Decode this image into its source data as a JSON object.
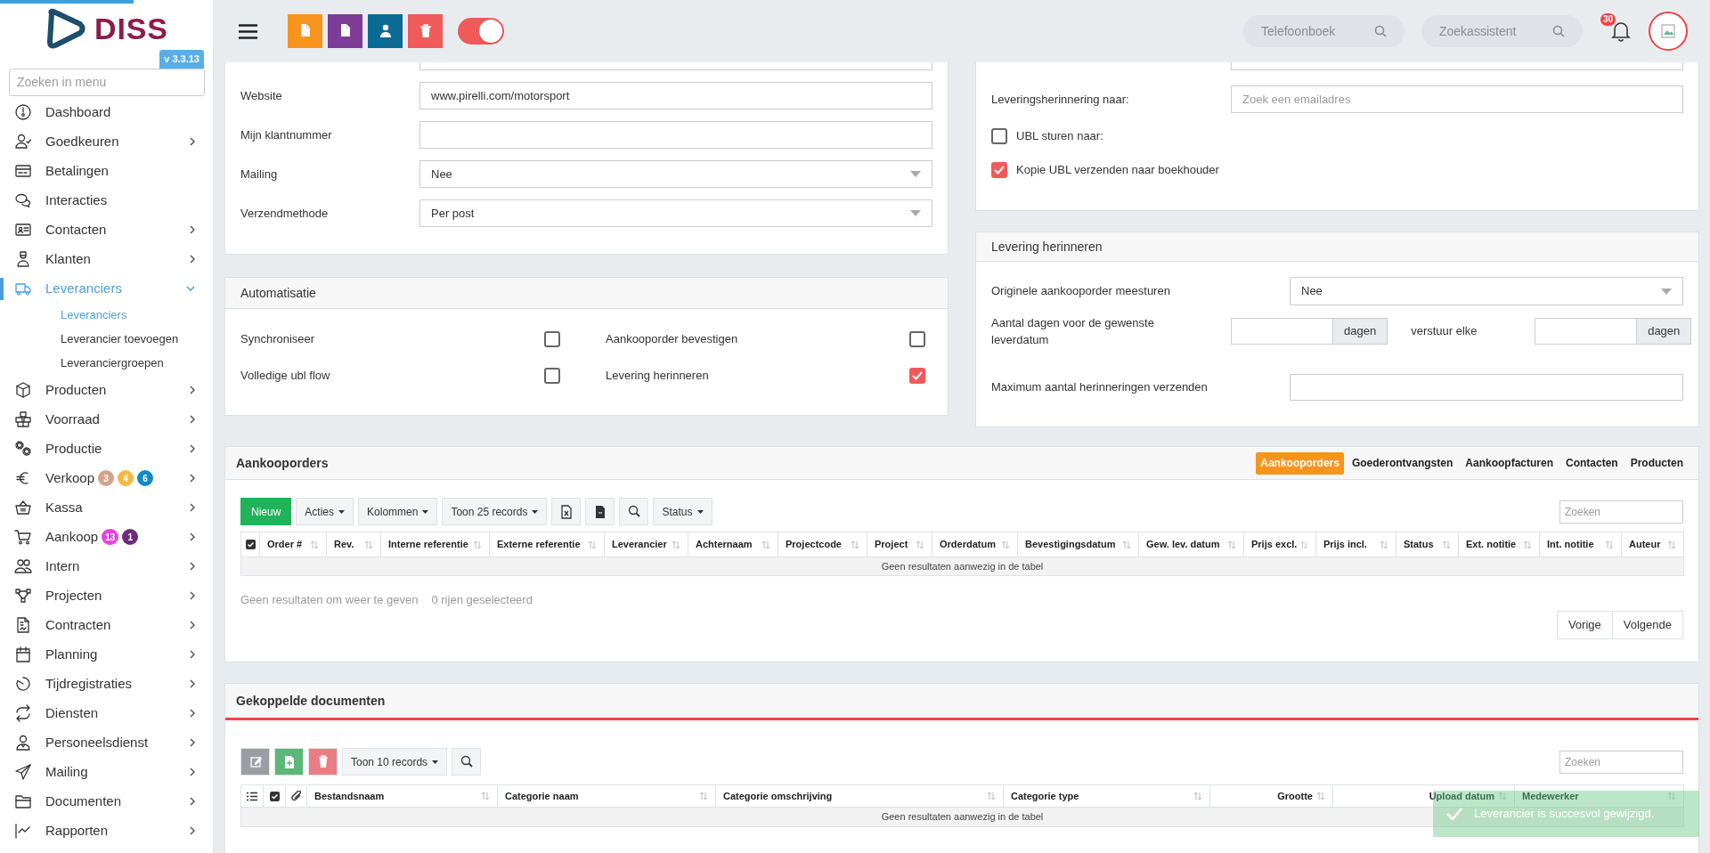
{
  "sidebar": {
    "logo": "DISS",
    "version": "v 3.3.13",
    "search": {
      "placeholder": "Zoeken in menu"
    },
    "items": [
      {
        "label": "Dashboard",
        "expandable": false,
        "selected": false
      },
      {
        "label": "Goedkeuren",
        "expandable": true,
        "expanded": false,
        "selected": false
      },
      {
        "label": "Betalingen",
        "expandable": false,
        "selected": false
      },
      {
        "label": "Interacties",
        "expandable": false,
        "selected": false
      },
      {
        "label": "Contacten",
        "expandable": true,
        "expanded": false,
        "selected": false
      },
      {
        "label": "Klanten",
        "expandable": true,
        "expanded": false,
        "selected": false
      },
      {
        "label": "Leveranciers",
        "expandable": true,
        "expanded": true,
        "selected": true,
        "children": [
          {
            "label": "Leveranciers",
            "selected": true
          },
          {
            "label": "Leverancier toevoegen",
            "selected": false
          },
          {
            "label": "Leveranciergroepen",
            "selected": false
          }
        ]
      },
      {
        "label": "Producten",
        "expandable": true,
        "expanded": false,
        "selected": false
      },
      {
        "label": "Voorraad",
        "expandable": true,
        "expanded": false,
        "selected": false
      },
      {
        "label": "Productie",
        "expandable": true,
        "expanded": false,
        "selected": false
      },
      {
        "label": "Verkoop",
        "expandable": true,
        "expanded": false,
        "selected": false,
        "badges": [
          {
            "text": "3",
            "color": "#d4a38a"
          },
          {
            "text": "4",
            "color": "#f5b942"
          },
          {
            "text": "6",
            "color": "#1289c4"
          }
        ]
      },
      {
        "label": "Kassa",
        "expandable": true,
        "expanded": false,
        "selected": false
      },
      {
        "label": "Aankoop",
        "expandable": true,
        "expanded": false,
        "selected": false,
        "badges": [
          {
            "text": "13",
            "color": "#e543e0"
          },
          {
            "text": "1",
            "color": "#6b2d7b"
          }
        ]
      },
      {
        "label": "Intern",
        "expandable": true,
        "expanded": false,
        "selected": false
      },
      {
        "label": "Projecten",
        "expandable": true,
        "expanded": false,
        "selected": false
      },
      {
        "label": "Contracten",
        "expandable": true,
        "expanded": false,
        "selected": false
      },
      {
        "label": "Planning",
        "expandable": true,
        "expanded": false,
        "selected": false
      },
      {
        "label": "Tijdregistraties",
        "expandable": true,
        "expanded": false,
        "selected": false
      },
      {
        "label": "Diensten",
        "expandable": true,
        "expanded": false,
        "selected": false
      },
      {
        "label": "Personeelsdienst",
        "expandable": true,
        "expanded": false,
        "selected": false
      },
      {
        "label": "Mailing",
        "expandable": true,
        "expanded": false,
        "selected": false
      },
      {
        "label": "Documenten",
        "expandable": true,
        "expanded": false,
        "selected": false
      },
      {
        "label": "Rapporten",
        "expandable": true,
        "expanded": false,
        "selected": false
      }
    ]
  },
  "topbar": {
    "actions": [
      {
        "kind": "file",
        "color": "#f7941d"
      },
      {
        "kind": "file",
        "color": "#7d3c98"
      },
      {
        "kind": "user",
        "color": "#0b6a94"
      },
      {
        "kind": "delete",
        "color": "#f05a5a"
      }
    ],
    "toggle": {
      "on": true
    },
    "searches": [
      {
        "placeholder": "Telefoonboek"
      },
      {
        "placeholder": "Zoekassistent"
      }
    ],
    "notifications": {
      "count": "30"
    }
  },
  "supplier_form": {
    "fields": [
      {
        "kind": "text"
      },
      {
        "kind": "text",
        "label": "Website",
        "value": "www.pirelli.com/motorsport"
      },
      {
        "kind": "text",
        "label": "Mijn klantnummer"
      },
      {
        "kind": "select",
        "label": "Mailing",
        "value": "Nee"
      },
      {
        "kind": "select",
        "label": "Verzendmethode",
        "value": "Per post"
      }
    ]
  },
  "mail_settings": {
    "fields": [
      {
        "kind": "text"
      },
      {
        "kind": "text",
        "label": "Leveringsherinnering naar:",
        "placeholder": "Zoek een emailadres"
      },
      {
        "kind": "checkbox",
        "label": "UBL sturen naar:",
        "checked": false
      },
      {
        "kind": "checkbox",
        "label": "Kopie UBL verzenden naar boekhouder",
        "checked": true
      }
    ]
  },
  "automation": {
    "title": "Automatisatie",
    "options": [
      {
        "label": "Synchroniseer",
        "checked": false
      },
      {
        "label": "Aankooporder bevestigen",
        "checked": false
      },
      {
        "label": "Volledige ubl flow",
        "checked": false
      },
      {
        "label": "Levering herinneren",
        "checked": true
      }
    ]
  },
  "delivery_reminder": {
    "title": "Levering herinneren",
    "original_label": "Originele aankooporder meesturen",
    "original_value": "Nee",
    "days_label": "Aantal dagen voor de gewenste leverdatum",
    "days_unit": "dagen",
    "repeat_label": "verstuur elke",
    "repeat_unit": "dagen",
    "max_label": "Maximum aantal herinneringen verzenden"
  },
  "purchase_orders": {
    "title": "Aankooporders",
    "tabs": [
      {
        "label": "Aankooporders",
        "selected": true
      },
      {
        "label": "Goederontvangsten",
        "selected": false
      },
      {
        "label": "Aankoopfacturen",
        "selected": false
      },
      {
        "label": "Contacten",
        "selected": false
      },
      {
        "label": "Producten",
        "selected": false
      }
    ],
    "toolbar": [
      {
        "kind": "primary",
        "label": "Nieuw"
      },
      {
        "kind": "dropdown",
        "label": "Acties"
      },
      {
        "kind": "dropdown",
        "label": "Kolommen"
      },
      {
        "kind": "dropdown",
        "label": "Toon 25 records"
      },
      {
        "kind": "excel"
      },
      {
        "kind": "file"
      },
      {
        "kind": "search"
      },
      {
        "kind": "dropdown",
        "label": "Status"
      }
    ],
    "search": {
      "placeholder": "Zoeken"
    },
    "columns": [
      {
        "kind": "check"
      },
      {
        "label": "Order #"
      },
      {
        "label": "Rev."
      },
      {
        "label": "Interne referentie"
      },
      {
        "label": "Externe referentie"
      },
      {
        "label": "Leverancier"
      },
      {
        "label": "Achternaam"
      },
      {
        "label": "Projectcode"
      },
      {
        "label": "Project"
      },
      {
        "label": "Orderdatum"
      },
      {
        "label": "Bevestigingsdatum"
      },
      {
        "label": "Gew. lev. datum"
      },
      {
        "label": "Prijs excl."
      },
      {
        "label": "Prijs incl."
      },
      {
        "label": "Status"
      },
      {
        "label": "Ext. notitie"
      },
      {
        "label": "Int. notitie"
      },
      {
        "label": "Auteur"
      }
    ],
    "empty": "Geen resultaten aanwezig in de tabel",
    "info": "Geen resultaten om weer te geven",
    "selected_info": "0 rijen geselecteerd",
    "pagination": [
      "Vorige",
      "Volgende"
    ]
  },
  "documents": {
    "title": "Gekoppelde documenten",
    "toolbar": [
      {
        "kind": "edit"
      },
      {
        "kind": "add"
      },
      {
        "kind": "delete"
      },
      {
        "kind": "dropdown",
        "label": "Toon 10 records"
      },
      {
        "kind": "search"
      }
    ],
    "search": {
      "placeholder": "Zoeken"
    },
    "columns": [
      {
        "kind": "list"
      },
      {
        "kind": "check"
      },
      {
        "kind": "attachment"
      },
      {
        "label": "Bestandsnaam"
      },
      {
        "label": "Categorie naam"
      },
      {
        "label": "Categorie omschrijving"
      },
      {
        "label": "Categorie type"
      },
      {
        "label": "Grootte"
      },
      {
        "label": "Upload datum"
      },
      {
        "label": "Medewerker"
      }
    ],
    "empty": "Geen resultaten aanwezig in de tabel"
  },
  "toast": {
    "message": "Leverancier is succesvol gewijzigd."
  }
}
